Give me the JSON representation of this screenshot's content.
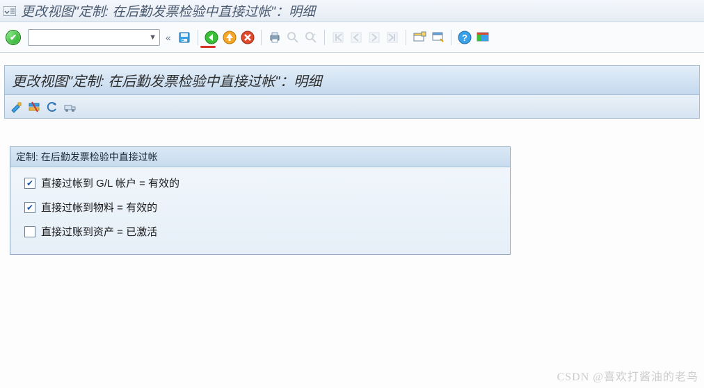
{
  "window": {
    "title": "更改视图\"定制: 在后勤发票检验中直接过帐\"：明细"
  },
  "toolbar": {
    "command_value": "",
    "icons": {
      "accept": "accept",
      "save": "save",
      "back": "back",
      "exit": "exit",
      "cancel": "cancel",
      "print": "print",
      "find": "find",
      "find_next": "find-next",
      "first": "first-page",
      "prev": "prev-page",
      "next": "next-page",
      "last": "last-page",
      "new_session": "new-session",
      "shortcut": "create-shortcut",
      "help": "help",
      "layout": "customize-layout"
    }
  },
  "page": {
    "title": "更改视图\"定制: 在后勤发票检验中直接过帐\"：明细"
  },
  "sub_toolbar": {
    "icons": {
      "other_entry": "other-entry",
      "delete": "delete",
      "undo": "undo",
      "transport": "transport"
    }
  },
  "group": {
    "title": "定制: 在后勤发票检验中直接过帐",
    "rows": [
      {
        "label": "直接过帐到 G/L 帐户 = 有效的",
        "checked": true
      },
      {
        "label": "直接过帐到物料 = 有效的",
        "checked": true
      },
      {
        "label": "直接过账到资产 = 已激活",
        "checked": false
      }
    ]
  },
  "watermark": "CSDN @喜欢打酱油的老鸟"
}
